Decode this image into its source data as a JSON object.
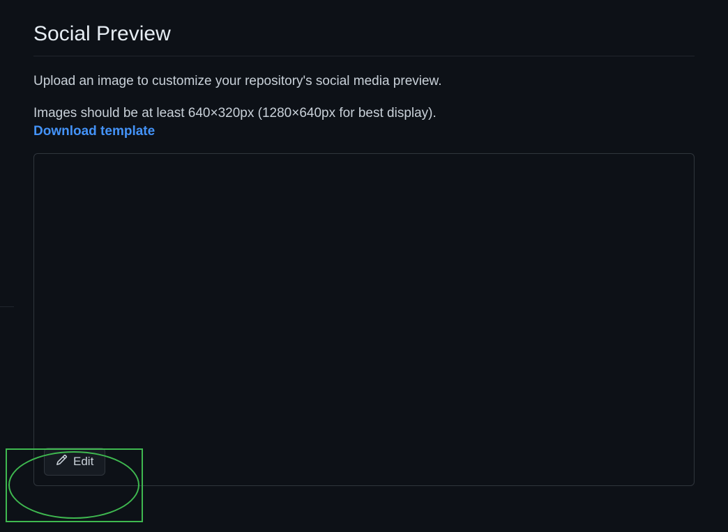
{
  "section": {
    "heading": "Social Preview",
    "description": "Upload an image to customize your repository's social media preview.",
    "sizeInfo": "Images should be at least 640×320px (1280×640px for best display).",
    "downloadLink": "Download template",
    "editButton": "Edit"
  }
}
